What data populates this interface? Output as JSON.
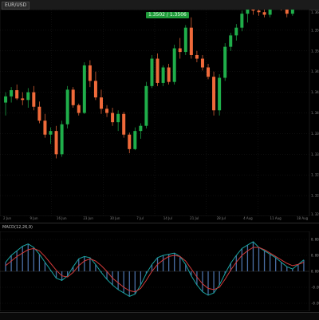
{
  "window": {
    "tab_label": "EUR/USD"
  },
  "price_badge": "1.3502 / 1.3506",
  "indicator": {
    "name": "MACD(12,26,9)"
  },
  "time_labels": [
    "2 Jun",
    "9 Jun",
    "16 Jun",
    "23 Jun",
    "30 Jun",
    "7 Jul",
    "14 Jul",
    "21 Jul",
    "28 Jul",
    "4 Aug",
    "11 Aug",
    "18 Aug"
  ],
  "price_axis_labels": [
    "1.3600",
    "1.3560",
    "1.3520",
    "1.3480",
    "1.3440",
    "1.3400",
    "1.3360",
    "1.3320",
    "1.3280",
    "1.3240",
    "1.3200"
  ],
  "osc_axis_labels": [
    "0.0030",
    "0.0015",
    "0.0000",
    "-0.0015",
    "-0.0030"
  ],
  "colors": {
    "bull": "#1fae4a",
    "bear": "#f06a3a",
    "macd_line": "#19a3a0",
    "signal_line": "#d33a3a",
    "hist": "#4a6fa5"
  },
  "chart_data": [
    {
      "type": "candlestick",
      "title": "",
      "ylim": [
        1.32,
        1.36
      ],
      "grid": true,
      "candles": [
        [
          1.342,
          1.344,
          1.3395,
          1.3432
        ],
        [
          1.3432,
          1.345,
          1.342,
          1.3444
        ],
        [
          1.3444,
          1.3455,
          1.3425,
          1.3428
        ],
        [
          1.3428,
          1.344,
          1.3415,
          1.3425
        ],
        [
          1.3425,
          1.3448,
          1.341,
          1.344
        ],
        [
          1.344,
          1.3452,
          1.3405,
          1.3412
        ],
        [
          1.3412,
          1.3422,
          1.338,
          1.3385
        ],
        [
          1.3385,
          1.3398,
          1.3352,
          1.3358
        ],
        [
          1.3358,
          1.3372,
          1.334,
          1.3365
        ],
        [
          1.3365,
          1.3375,
          1.3312,
          1.332
        ],
        [
          1.332,
          1.3385,
          1.3315,
          1.3378
        ],
        [
          1.3378,
          1.3452,
          1.337,
          1.3445
        ],
        [
          1.3445,
          1.345,
          1.341,
          1.3415
        ],
        [
          1.3415,
          1.3418,
          1.3395,
          1.34
        ],
        [
          1.34,
          1.3498,
          1.3398,
          1.3492
        ],
        [
          1.3492,
          1.3502,
          1.345,
          1.3462
        ],
        [
          1.3462,
          1.348,
          1.3425,
          1.343
        ],
        [
          1.343,
          1.3445,
          1.3398,
          1.3408
        ],
        [
          1.3408,
          1.3415,
          1.3392,
          1.34
        ],
        [
          1.34,
          1.341,
          1.3375,
          1.3382
        ],
        [
          1.3382,
          1.3405,
          1.3365,
          1.3398
        ],
        [
          1.3398,
          1.3402,
          1.3352,
          1.3358
        ],
        [
          1.3358,
          1.3362,
          1.3322,
          1.333
        ],
        [
          1.333,
          1.3372,
          1.3328,
          1.3365
        ],
        [
          1.3365,
          1.338,
          1.335,
          1.3375
        ],
        [
          1.3375,
          1.346,
          1.337,
          1.3452
        ],
        [
          1.3452,
          1.3512,
          1.3448,
          1.3505
        ],
        [
          1.3505,
          1.3515,
          1.3452,
          1.3458
        ],
        [
          1.3458,
          1.3492,
          1.3452,
          1.3488
        ],
        [
          1.3488,
          1.3495,
          1.3455,
          1.346
        ],
        [
          1.346,
          1.3532,
          1.3455,
          1.3525
        ],
        [
          1.3525,
          1.3545,
          1.3505,
          1.3518
        ],
        [
          1.3518,
          1.357,
          1.3512,
          1.3565
        ],
        [
          1.3565,
          1.3585,
          1.3505,
          1.3512
        ],
        [
          1.3512,
          1.352,
          1.3498,
          1.3505
        ],
        [
          1.3505,
          1.3512,
          1.3482,
          1.3488
        ],
        [
          1.3488,
          1.3495,
          1.3465,
          1.347
        ],
        [
          1.347,
          1.348,
          1.3395,
          1.3405
        ],
        [
          1.3405,
          1.3475,
          1.3395,
          1.3468
        ],
        [
          1.3468,
          1.3535,
          1.3462,
          1.3528
        ],
        [
          1.3528,
          1.3555,
          1.352,
          1.355
        ],
        [
          1.355,
          1.3572,
          1.354,
          1.3565
        ],
        [
          1.3565,
          1.3598,
          1.3558,
          1.3592
        ],
        [
          1.3592,
          1.361,
          1.3575,
          1.3602
        ],
        [
          1.3602,
          1.3612,
          1.359,
          1.3598
        ],
        [
          1.3598,
          1.3605,
          1.3588,
          1.3595
        ],
        [
          1.3595,
          1.36,
          1.3585,
          1.359
        ],
        [
          1.359,
          1.361,
          1.3585,
          1.3605
        ],
        [
          1.3605,
          1.3628,
          1.36,
          1.3622
        ],
        [
          1.3622,
          1.363,
          1.3598,
          1.3608
        ],
        [
          1.3608,
          1.3612,
          1.3585,
          1.3592
        ],
        [
          1.3592,
          1.362,
          1.3588,
          1.3615
        ],
        [
          1.3615,
          1.366,
          1.3612,
          1.3655
        ],
        [
          1.3655,
          1.372,
          1.365,
          1.3712
        ]
      ]
    },
    {
      "type": "line",
      "title": "MACD(12,26,9)",
      "ylim": [
        -0.0035,
        0.0035
      ],
      "grid": true,
      "series": [
        {
          "values": [
            0.0008,
            0.0014,
            0.0018,
            0.0022,
            0.0024,
            0.0021,
            0.0015,
            0.0008,
            0.0001,
            -0.0006,
            -0.0008,
            -0.0004,
            0.0004,
            0.0011,
            0.0013,
            0.0012,
            0.0006,
            -0.0001,
            -0.0007,
            -0.0012,
            -0.0016,
            -0.0019,
            -0.0022,
            -0.002,
            -0.0012,
            -0.0002,
            0.0006,
            0.0012,
            0.0014,
            0.0015,
            0.0016,
            0.0013,
            0.0006,
            -0.0004,
            -0.0012,
            -0.0018,
            -0.0021,
            -0.0019,
            -0.0012,
            -0.0002,
            0.0007,
            0.0014,
            0.002,
            0.0023,
            0.0026,
            0.0021,
            0.0018,
            0.0015,
            0.0012,
            0.0008,
            0.0004,
            0.0002,
            0.0006,
            0.001
          ]
        },
        {
          "values": [
            0.0005,
            0.0009,
            0.0013,
            0.0016,
            0.0019,
            0.002,
            0.0018,
            0.0013,
            0.0007,
            0.0001,
            -0.0004,
            -0.0005,
            -0.0001,
            0.0005,
            0.0009,
            0.0011,
            0.0009,
            0.0005,
            0.0,
            -0.0006,
            -0.001,
            -0.0014,
            -0.0017,
            -0.0018,
            -0.0015,
            -0.0008,
            0.0,
            0.0006,
            0.001,
            0.0013,
            0.0014,
            0.0013,
            0.0009,
            0.0002,
            -0.0005,
            -0.0011,
            -0.0015,
            -0.0016,
            -0.0014,
            -0.0007,
            0.0001,
            0.0008,
            0.0014,
            0.0018,
            0.0021,
            0.0021,
            0.0019,
            0.0016,
            0.0013,
            0.001,
            0.0007,
            0.0005,
            0.0006,
            0.0008
          ]
        }
      ],
      "histogram": [
        0.0008,
        0.0014,
        0.0018,
        0.0022,
        0.0024,
        0.0021,
        0.0015,
        0.0008,
        0.0001,
        -0.0006,
        -0.0008,
        -0.0004,
        0.0004,
        0.0011,
        0.0013,
        0.0012,
        0.0006,
        -0.0001,
        -0.0007,
        -0.0012,
        -0.0016,
        -0.0019,
        -0.0022,
        -0.002,
        -0.0012,
        -0.0002,
        0.0006,
        0.0012,
        0.0014,
        0.0015,
        0.0016,
        0.0013,
        0.0006,
        -0.0004,
        -0.0012,
        -0.0018,
        -0.0021,
        -0.0019,
        -0.0012,
        -0.0002,
        0.0007,
        0.0014,
        0.002,
        0.0023,
        0.0026,
        0.0021,
        0.0018,
        0.0015,
        0.0012,
        0.0008,
        0.0004,
        0.0002,
        0.0006,
        0.001
      ]
    }
  ]
}
